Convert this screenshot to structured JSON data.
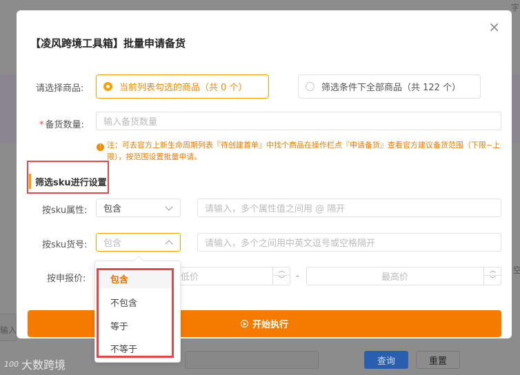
{
  "dialog": {
    "title": "【凌风跨境工具箱】批量申请备货",
    "close": "×"
  },
  "goods": {
    "label": "请选择商品:",
    "option_selected": "当前列表勾选的商品（共 0 个）",
    "option_all": "筛选条件下全部商品（共 122 个）"
  },
  "quantity": {
    "required_mark": "*",
    "label": "备货数量:",
    "placeholder": "输入备货数量"
  },
  "note": {
    "icon": "!",
    "text": "注：可去官方上新生命周期列表『待创建首单』中找个商品在操作栏点『申请备货』查看官方建议备货范围（下限~上限），按范围设置批量申请。"
  },
  "sku_section": {
    "title": "筛选sku进行设置"
  },
  "attr_filter": {
    "label": "按sku属性:",
    "select_value": "包含",
    "placeholder": "请输入，多个属性值之间用 @ 隔开"
  },
  "code_filter": {
    "label": "按sku货号:",
    "select_placeholder": "包含",
    "placeholder": "请输入，多个之间用中英文逗号或空格隔开"
  },
  "price_filter": {
    "label": "按申报价:",
    "min_placeholder": "低价",
    "separator": "-",
    "max_placeholder": "最高价"
  },
  "run_button": {
    "label": "开始执行"
  },
  "dropdown": {
    "options": [
      "包含",
      "不包含",
      "等于",
      "不等于"
    ],
    "selected": "包含"
  },
  "background": {
    "corner_text": "字",
    "input_label": "输入",
    "side_text": "空",
    "query_button": "查询",
    "reset_button": "重置",
    "watermark": "大数跨境",
    "watermark_logo": "100"
  },
  "colors": {
    "accent": "#f7a100",
    "primary_button": "#f57a00",
    "annotation_red": "#e2474c",
    "note_text": "#ea7c00"
  }
}
